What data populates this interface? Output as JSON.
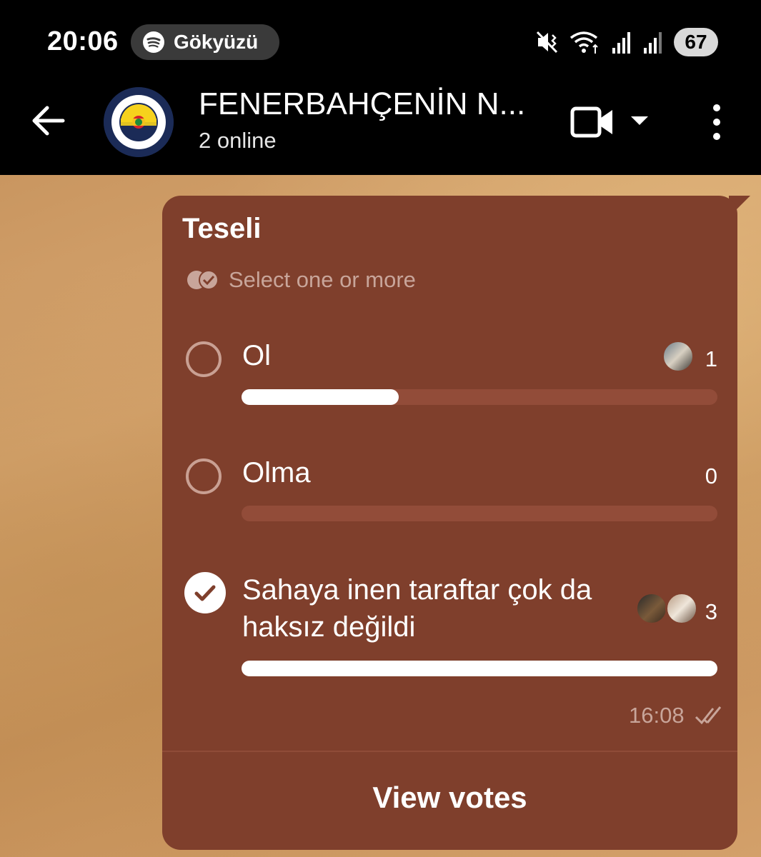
{
  "status_bar": {
    "time": "20:06",
    "now_playing": "Gökyüzü",
    "battery": "67",
    "icons": [
      "spotify-icon",
      "mute-vibrate-icon",
      "wifi-icon",
      "signal-icon",
      "signal-icon",
      "battery-icon"
    ]
  },
  "header": {
    "title": "FENERBAHÇENİN N...",
    "subtitle": "2 online",
    "icons": [
      "back-arrow-icon",
      "video-call-icon",
      "caret-down-icon",
      "more-vert-icon"
    ]
  },
  "poll": {
    "question": "Teseli",
    "type_hint": "Select one or more",
    "options": [
      {
        "label": "Ol",
        "votes": "1",
        "fraction": 0.33,
        "selected": false
      },
      {
        "label": "Olma",
        "votes": "0",
        "fraction": 0.0,
        "selected": false
      },
      {
        "label": "Sahaya inen taraftar çok da haksız değildi",
        "votes": "3",
        "fraction": 1.0,
        "selected": true
      }
    ],
    "time": "16:08",
    "view_votes": "View votes"
  },
  "colors": {
    "bubble": "#7f3f2c",
    "bar_track": "#924c39",
    "bar_fill": "#ffffff",
    "muted_text": "#c8a59a"
  }
}
